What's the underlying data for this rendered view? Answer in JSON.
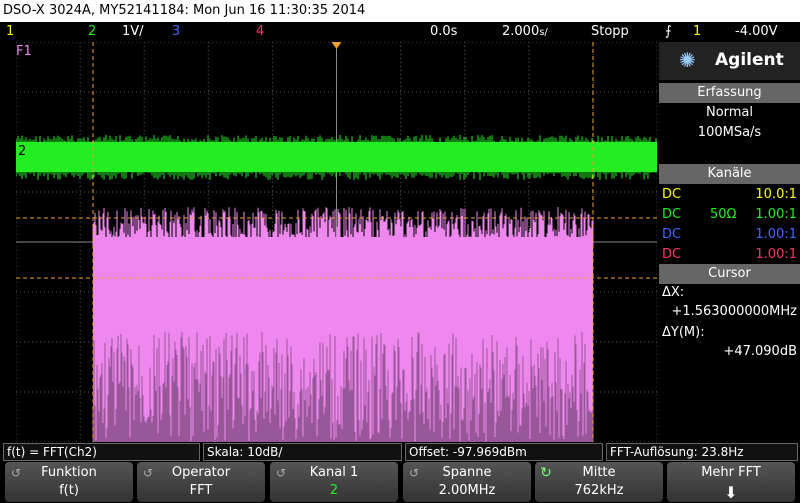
{
  "title": "DSO-X 3024A, MY52141184: Mon Jun 16 11:30:35 2014",
  "status": {
    "ch1": "1",
    "ch2": "2",
    "ch2_scale": "1",
    "ch3": "3",
    "ch4": "4",
    "time_offset": "0.0s",
    "time_base": "2.000",
    "time_unit": "s/",
    "run_state": "Stopp",
    "trigger_channel": "1",
    "trigger_level": "-4.00V"
  },
  "screen": {
    "fft_label": "F1",
    "ch2_marker": "2",
    "colors": {
      "grid": "#5a5a5a",
      "ch2": "#22ee22",
      "fft": "#ee88ee",
      "cursor": "#f0a030"
    }
  },
  "panel": {
    "brand": "Agilent",
    "acquisition_header": "Erfassung",
    "acquisition_mode": "Normal",
    "sample_rate": "100MSa/s",
    "channels_header": "Kanäle",
    "channels": [
      {
        "coupling": "DC",
        "impedance": "",
        "probe": "10.0:1",
        "color": "#ffff00"
      },
      {
        "coupling": "DC",
        "impedance": "50Ω",
        "probe": "1.00:1",
        "color": "#22ee22"
      },
      {
        "coupling": "DC",
        "impedance": "",
        "probe": "1.00:1",
        "color": "#4466ff"
      },
      {
        "coupling": "DC",
        "impedance": "",
        "probe": "1.00:1",
        "color": "#ff3366"
      }
    ],
    "cursor_header": "Cursor",
    "dx_label": "ΔX:",
    "dx_value": "+1.563000000MHz",
    "dy_label": "ΔY(M):",
    "dy_value": "+47.090dB"
  },
  "bottom": {
    "function": "f(t) = FFT(Ch2)",
    "scale": "Skala: 10dB/",
    "offset": "Offset: -97.969dBm",
    "resolution": "FFT-Auflösung: 23.8Hz"
  },
  "softkeys": [
    {
      "label": "Funktion",
      "value": "f(t)"
    },
    {
      "label": "Operator",
      "value": "FFT"
    },
    {
      "label": "Kanal 1",
      "value": "2"
    },
    {
      "label": "Spanne",
      "value": "2.00MHz"
    },
    {
      "label": "Mitte",
      "value": "762kHz"
    },
    {
      "label": "Mehr FFT",
      "value": ""
    }
  ]
}
